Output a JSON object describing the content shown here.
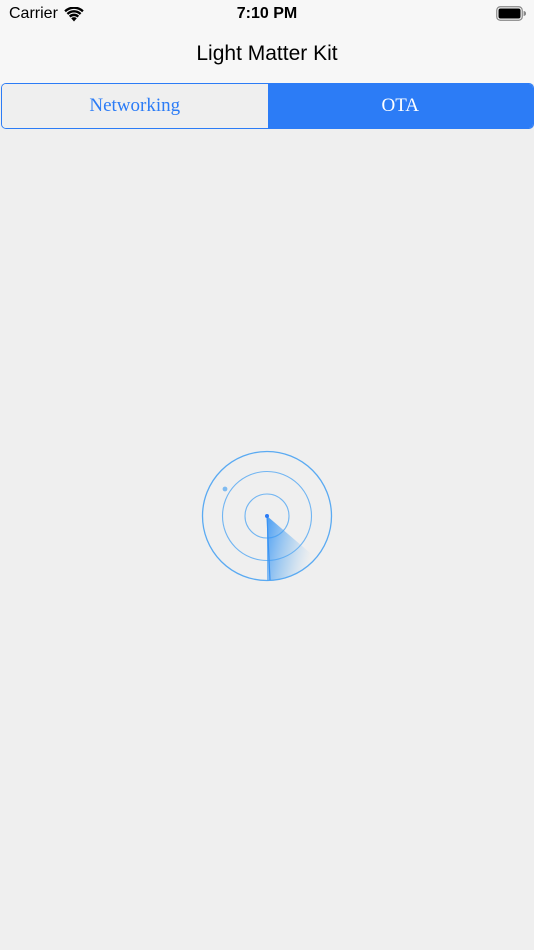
{
  "status_bar": {
    "carrier": "Carrier",
    "time": "7:10 PM",
    "icons": [
      "wifi-icon",
      "battery-icon"
    ]
  },
  "nav": {
    "title": "Light Matter Kit"
  },
  "tabs": [
    {
      "label": "Networking",
      "selected": false
    },
    {
      "label": "OTA",
      "selected": true
    }
  ],
  "radar": {
    "icon": "radar-scan-icon",
    "rings": 3
  },
  "colors": {
    "accent": "#2c7cf6",
    "background": "#efefef",
    "topbar": "#f7f7f7",
    "radar": "#5aaaf2"
  }
}
